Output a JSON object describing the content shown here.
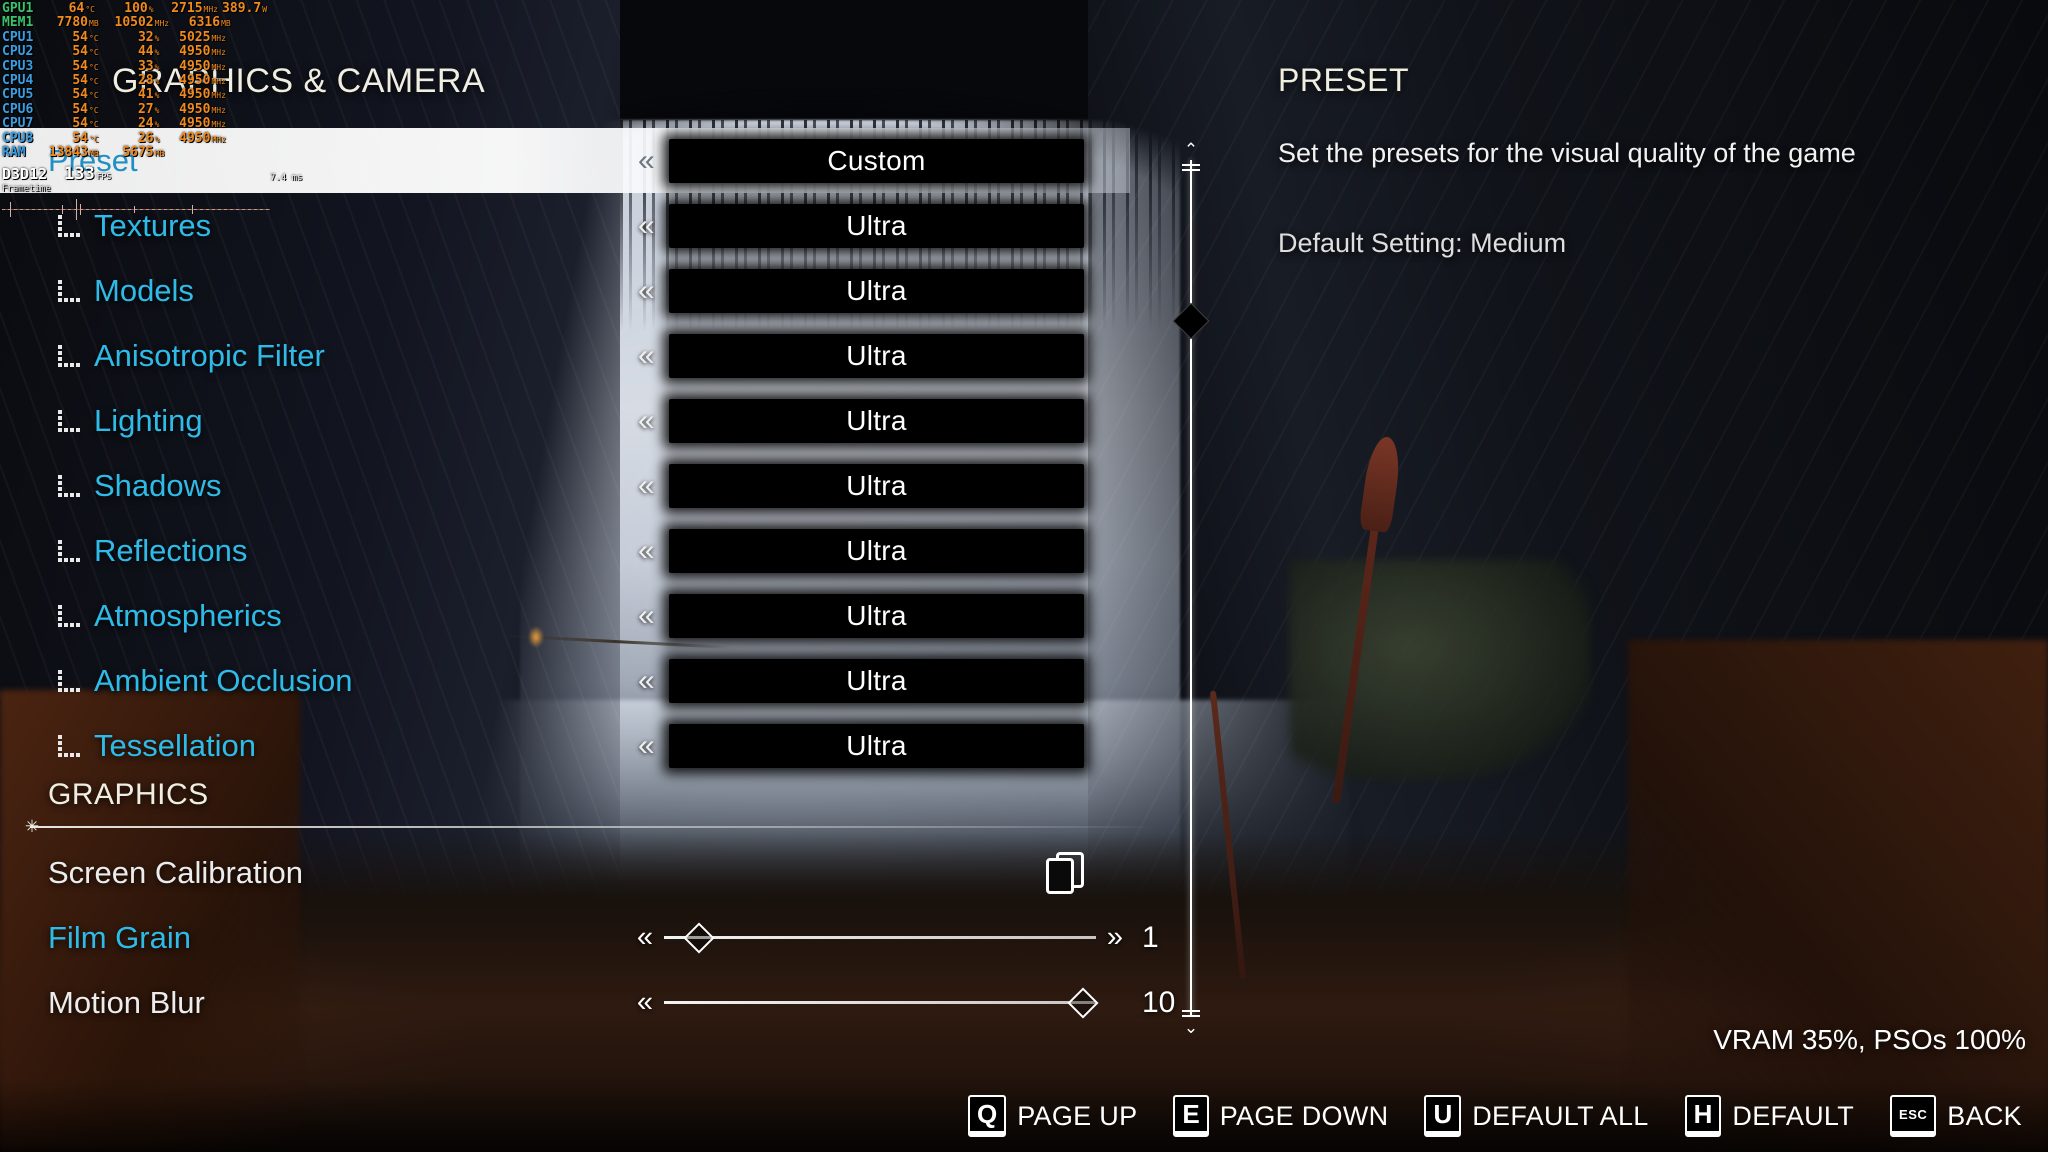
{
  "perf_overlay": {
    "rows": [
      {
        "label": "GPU",
        "sub": "1",
        "cells": [
          {
            "v": "64",
            "u": "°C"
          },
          {
            "v": "100",
            "u": "%"
          },
          {
            "v": "2715",
            "u": "MHz"
          },
          {
            "v": "389.7",
            "u": "W"
          }
        ]
      },
      {
        "label": "MEM",
        "sub": "1",
        "cells": [
          {
            "v": "7780",
            "u": "MB"
          },
          {
            "v": "10502",
            "u": "MHz"
          },
          {
            "v": "6316",
            "u": "MB"
          }
        ]
      },
      {
        "label": "CPU",
        "sub": "1",
        "cells": [
          {
            "v": "54",
            "u": "°C"
          },
          {
            "v": "32",
            "u": "%"
          },
          {
            "v": "5025",
            "u": "MHz"
          }
        ]
      },
      {
        "label": "CPU",
        "sub": "2",
        "cells": [
          {
            "v": "54",
            "u": "°C"
          },
          {
            "v": "44",
            "u": "%"
          },
          {
            "v": "4950",
            "u": "MHz"
          }
        ]
      },
      {
        "label": "CPU",
        "sub": "3",
        "cells": [
          {
            "v": "54",
            "u": "°C"
          },
          {
            "v": "33",
            "u": "%"
          },
          {
            "v": "4950",
            "u": "MHz"
          }
        ]
      },
      {
        "label": "CPU",
        "sub": "4",
        "cells": [
          {
            "v": "54",
            "u": "°C"
          },
          {
            "v": "28",
            "u": "%"
          },
          {
            "v": "4950",
            "u": "MHz"
          }
        ]
      },
      {
        "label": "CPU",
        "sub": "5",
        "cells": [
          {
            "v": "54",
            "u": "°C"
          },
          {
            "v": "41",
            "u": "%"
          },
          {
            "v": "4950",
            "u": "MHz"
          }
        ]
      },
      {
        "label": "CPU",
        "sub": "6",
        "cells": [
          {
            "v": "54",
            "u": "°C"
          },
          {
            "v": "27",
            "u": "%"
          },
          {
            "v": "4950",
            "u": "MHz"
          }
        ]
      },
      {
        "label": "CPU",
        "sub": "7",
        "cells": [
          {
            "v": "54",
            "u": "°C"
          },
          {
            "v": "24",
            "u": "%"
          },
          {
            "v": "4950",
            "u": "MHz"
          }
        ]
      },
      {
        "label": "CPU",
        "sub": "8",
        "cells": [
          {
            "v": "54",
            "u": "°C"
          },
          {
            "v": "26",
            "u": "%"
          },
          {
            "v": "4950",
            "u": "MHz"
          }
        ]
      },
      {
        "label": "RAM",
        "sub": "",
        "cells": [
          {
            "v": "13843",
            "u": "MB"
          },
          {
            "v": "5675",
            "u": "MB"
          }
        ]
      }
    ],
    "api": "D3D12",
    "fps": "133",
    "fps_unit": "FPS",
    "frametime_label": "Frametime",
    "frametime_ms": "7.4 ms",
    "color_label_gpu": "#3ac26a",
    "color_label_cpu": "#3a9ee0",
    "color_value": "#f08a1e"
  },
  "header": {
    "screen_title": "GRAPHICS & CAMERA"
  },
  "info_panel": {
    "title": "PRESET",
    "description": "Set the presets for the visual quality of the game",
    "default_setting": "Default Setting: Medium"
  },
  "settings": {
    "preset_row": {
      "label": "Preset",
      "value": "Custom",
      "left_chevron": "«"
    },
    "quality_rows": [
      {
        "label": "Textures",
        "value": "Ultra"
      },
      {
        "label": "Models",
        "value": "Ultra"
      },
      {
        "label": "Anisotropic Filter",
        "value": "Ultra"
      },
      {
        "label": "Lighting",
        "value": "Ultra"
      },
      {
        "label": "Shadows",
        "value": "Ultra"
      },
      {
        "label": "Reflections",
        "value": "Ultra"
      },
      {
        "label": "Atmospherics",
        "value": "Ultra"
      },
      {
        "label": "Ambient Occlusion",
        "value": "Ultra"
      },
      {
        "label": "Tessellation",
        "value": "Ultra"
      }
    ],
    "section_graphics": {
      "title": "GRAPHICS"
    },
    "screen_calibration": {
      "label": "Screen Calibration",
      "icon": "screen-calibration-icon"
    },
    "film_grain": {
      "label": "Film Grain",
      "value": "1",
      "percent": 8,
      "left_chevron": "«",
      "right_chevron": "»"
    },
    "motion_blur": {
      "label": "Motion Blur",
      "value": "10",
      "percent": 97,
      "left_chevron": "«",
      "right_chevron": ""
    }
  },
  "status": {
    "vram": "VRAM 35%, PSOs 100%"
  },
  "footer": {
    "keys": [
      {
        "cap": "Q",
        "label": "PAGE UP"
      },
      {
        "cap": "E",
        "label": "PAGE DOWN"
      },
      {
        "cap": "U",
        "label": "DEFAULT ALL"
      },
      {
        "cap": "H",
        "label": "DEFAULT"
      },
      {
        "cap": "ESC",
        "label": "BACK"
      }
    ]
  },
  "colors": {
    "accent_cyan": "#2fbbe8",
    "title_cream": "#efeee0",
    "value_white": "#ffffff",
    "overlay_orange": "#f08a1e",
    "overlay_green": "#3ac26a",
    "overlay_blue": "#3a9ee0"
  }
}
